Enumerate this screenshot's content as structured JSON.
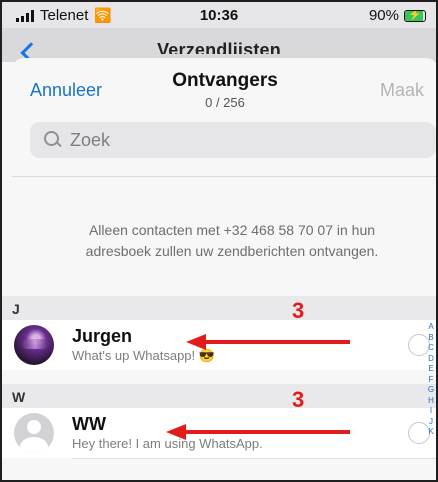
{
  "status_bar": {
    "carrier": "Telenet",
    "time": "10:36",
    "battery_percent": "90%",
    "battery_level": 0.9
  },
  "background_page": {
    "title": "Verzendlijsten"
  },
  "sheet": {
    "cancel_label": "Annuleer",
    "title": "Ontvangers",
    "count": "0 / 256",
    "create_label": "Maak",
    "search_placeholder": "Zoek",
    "info_line1": "Alleen contacten met +32 468 58 70 07 in hun",
    "info_line2": "adresboek zullen uw zendberichten ontvangen."
  },
  "sections": [
    {
      "letter": "J",
      "contacts": [
        {
          "name": "Jurgen",
          "about": "What's up Whatsapp! 😎"
        }
      ]
    },
    {
      "letter": "W",
      "contacts": [
        {
          "name": "WW",
          "about": "Hey there! I am using WhatsApp."
        }
      ]
    }
  ],
  "annotations": [
    {
      "label": "3"
    },
    {
      "label": "3"
    }
  ],
  "index_letters": [
    "A",
    "B",
    "C",
    "D",
    "E",
    "F",
    "G",
    "H",
    "I",
    "J",
    "K"
  ],
  "colors": {
    "accent": "#1a73c8",
    "annotation": "#e41b1b",
    "battery": "#34c759"
  }
}
